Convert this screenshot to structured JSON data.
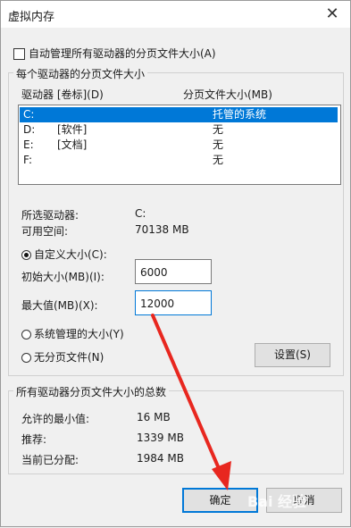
{
  "window": {
    "title": "虚拟内存",
    "close_glyph": "✕"
  },
  "auto_manage": {
    "label": "自动管理所有驱动器的分页文件大小(A)",
    "checked": false
  },
  "drives_group": {
    "title": "每个驱动器的分页文件大小",
    "col_drive": "驱动器 [卷标](D)",
    "col_size": "分页文件大小(MB)",
    "rows": [
      {
        "drive": "C:",
        "label": "",
        "size": "托管的系统",
        "selected": true
      },
      {
        "drive": "D:",
        "label": "[软件]",
        "size": "无",
        "selected": false
      },
      {
        "drive": "E:",
        "label": "[文档]",
        "size": "无",
        "selected": false
      },
      {
        "drive": "F:",
        "label": "",
        "size": "无",
        "selected": false
      }
    ],
    "selected_drive_label": "所选驱动器:",
    "selected_drive_value": "C:",
    "free_space_label": "可用空间:",
    "free_space_value": "70138 MB",
    "custom_size_label": "自定义大小(C):",
    "initial_label": "初始大小(MB)(I):",
    "initial_value": "6000",
    "max_label": "最大值(MB)(X):",
    "max_value": "12000",
    "system_managed_label": "系统管理的大小(Y)",
    "no_paging_label": "无分页文件(N)",
    "set_button": "设置(S)"
  },
  "totals_group": {
    "title": "所有驱动器分页文件大小的总数",
    "min_label": "允许的最小值:",
    "min_value": "16 MB",
    "recommended_label": "推荐:",
    "recommended_value": "1339 MB",
    "current_label": "当前已分配:",
    "current_value": "1984 MB"
  },
  "buttons": {
    "ok": "确定",
    "cancel": "取消"
  },
  "colors": {
    "accent": "#0078d7",
    "arrow": "#e8271f"
  },
  "watermark": "Bai 经验"
}
